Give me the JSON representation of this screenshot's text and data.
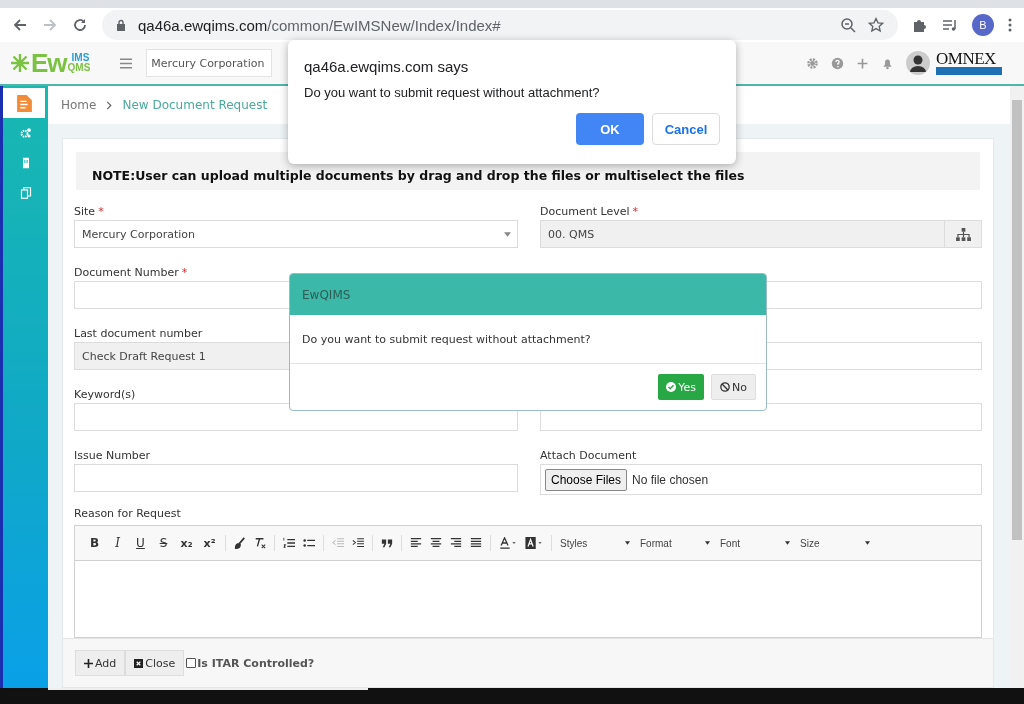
{
  "browser": {
    "url_host": "qa46a.ewqims.com",
    "url_path": "/common/EwIMSNew/Index/Index#",
    "profile": "B"
  },
  "header": {
    "logo": {
      "main": "Ew",
      "top": "IMS",
      "bottom": "QMS"
    },
    "site": "Mercury Corporation",
    "brand": "OMNEX"
  },
  "sidebar": {
    "items": [
      {
        "selected": true
      },
      {
        "selected": false
      },
      {
        "selected": false
      },
      {
        "selected": false
      }
    ]
  },
  "breadcrumb": [
    "Home",
    "New Document Request"
  ],
  "note": "NOTE:User can upload multiple documents by drag and drop the files or multiselect the files",
  "required_mark": "*",
  "fields": [
    {
      "label": "Site",
      "required": true,
      "kind": "select",
      "value": "Mercury Corporation"
    },
    {
      "label": "Document Level",
      "required": true,
      "kind": "picker",
      "value": "00. QMS"
    },
    {
      "label": "Document Number",
      "required": true,
      "kind": "input"
    },
    {
      "kind": "input"
    },
    {
      "label": "Last document number",
      "required": false,
      "kind": "readonly",
      "value": "Check Draft Request 1"
    },
    {
      "kind": "input"
    },
    {
      "label": "Keyword(s)",
      "required": false,
      "kind": "input"
    },
    {
      "kind": "input"
    },
    {
      "label": "Issue Number",
      "required": false,
      "kind": "input"
    },
    {
      "label": "Attach Document",
      "required": false,
      "kind": "file",
      "button": "Choose Files",
      "value": "No file chosen"
    }
  ],
  "editor": {
    "label": "Reason for Request",
    "glyphs": [
      "B",
      "I",
      "U",
      "S",
      "x₂",
      "x²"
    ],
    "dropdowns": [
      "Styles",
      "Format",
      "Font",
      "Size"
    ]
  },
  "footer": {
    "add": "Add",
    "close": "Close",
    "itar": {
      "label": "Is ITAR Controlled?",
      "checked": false
    }
  },
  "browser_dialog": {
    "title": "qa46a.ewqims.com says",
    "message": "Do you want to submit request without attachment?",
    "ok": "OK",
    "cancel": "Cancel"
  },
  "modal": {
    "title": "EwQIMS",
    "message": "Do you want to submit request without attachment?",
    "yes": "Yes",
    "no": "No"
  }
}
